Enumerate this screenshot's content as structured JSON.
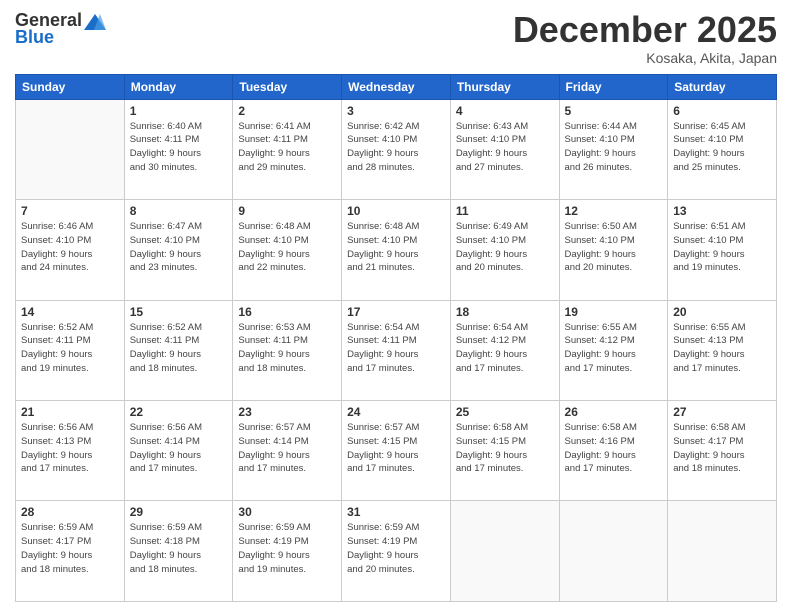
{
  "header": {
    "logo": {
      "general": "General",
      "blue": "Blue"
    },
    "title": "December 2025",
    "subtitle": "Kosaka, Akita, Japan"
  },
  "days_of_week": [
    "Sunday",
    "Monday",
    "Tuesday",
    "Wednesday",
    "Thursday",
    "Friday",
    "Saturday"
  ],
  "weeks": [
    [
      {
        "day": "",
        "info": ""
      },
      {
        "day": "1",
        "info": "Sunrise: 6:40 AM\nSunset: 4:11 PM\nDaylight: 9 hours\nand 30 minutes."
      },
      {
        "day": "2",
        "info": "Sunrise: 6:41 AM\nSunset: 4:11 PM\nDaylight: 9 hours\nand 29 minutes."
      },
      {
        "day": "3",
        "info": "Sunrise: 6:42 AM\nSunset: 4:10 PM\nDaylight: 9 hours\nand 28 minutes."
      },
      {
        "day": "4",
        "info": "Sunrise: 6:43 AM\nSunset: 4:10 PM\nDaylight: 9 hours\nand 27 minutes."
      },
      {
        "day": "5",
        "info": "Sunrise: 6:44 AM\nSunset: 4:10 PM\nDaylight: 9 hours\nand 26 minutes."
      },
      {
        "day": "6",
        "info": "Sunrise: 6:45 AM\nSunset: 4:10 PM\nDaylight: 9 hours\nand 25 minutes."
      }
    ],
    [
      {
        "day": "7",
        "info": "Sunrise: 6:46 AM\nSunset: 4:10 PM\nDaylight: 9 hours\nand 24 minutes."
      },
      {
        "day": "8",
        "info": "Sunrise: 6:47 AM\nSunset: 4:10 PM\nDaylight: 9 hours\nand 23 minutes."
      },
      {
        "day": "9",
        "info": "Sunrise: 6:48 AM\nSunset: 4:10 PM\nDaylight: 9 hours\nand 22 minutes."
      },
      {
        "day": "10",
        "info": "Sunrise: 6:48 AM\nSunset: 4:10 PM\nDaylight: 9 hours\nand 21 minutes."
      },
      {
        "day": "11",
        "info": "Sunrise: 6:49 AM\nSunset: 4:10 PM\nDaylight: 9 hours\nand 20 minutes."
      },
      {
        "day": "12",
        "info": "Sunrise: 6:50 AM\nSunset: 4:10 PM\nDaylight: 9 hours\nand 20 minutes."
      },
      {
        "day": "13",
        "info": "Sunrise: 6:51 AM\nSunset: 4:10 PM\nDaylight: 9 hours\nand 19 minutes."
      }
    ],
    [
      {
        "day": "14",
        "info": "Sunrise: 6:52 AM\nSunset: 4:11 PM\nDaylight: 9 hours\nand 19 minutes."
      },
      {
        "day": "15",
        "info": "Sunrise: 6:52 AM\nSunset: 4:11 PM\nDaylight: 9 hours\nand 18 minutes."
      },
      {
        "day": "16",
        "info": "Sunrise: 6:53 AM\nSunset: 4:11 PM\nDaylight: 9 hours\nand 18 minutes."
      },
      {
        "day": "17",
        "info": "Sunrise: 6:54 AM\nSunset: 4:11 PM\nDaylight: 9 hours\nand 17 minutes."
      },
      {
        "day": "18",
        "info": "Sunrise: 6:54 AM\nSunset: 4:12 PM\nDaylight: 9 hours\nand 17 minutes."
      },
      {
        "day": "19",
        "info": "Sunrise: 6:55 AM\nSunset: 4:12 PM\nDaylight: 9 hours\nand 17 minutes."
      },
      {
        "day": "20",
        "info": "Sunrise: 6:55 AM\nSunset: 4:13 PM\nDaylight: 9 hours\nand 17 minutes."
      }
    ],
    [
      {
        "day": "21",
        "info": "Sunrise: 6:56 AM\nSunset: 4:13 PM\nDaylight: 9 hours\nand 17 minutes."
      },
      {
        "day": "22",
        "info": "Sunrise: 6:56 AM\nSunset: 4:14 PM\nDaylight: 9 hours\nand 17 minutes."
      },
      {
        "day": "23",
        "info": "Sunrise: 6:57 AM\nSunset: 4:14 PM\nDaylight: 9 hours\nand 17 minutes."
      },
      {
        "day": "24",
        "info": "Sunrise: 6:57 AM\nSunset: 4:15 PM\nDaylight: 9 hours\nand 17 minutes."
      },
      {
        "day": "25",
        "info": "Sunrise: 6:58 AM\nSunset: 4:15 PM\nDaylight: 9 hours\nand 17 minutes."
      },
      {
        "day": "26",
        "info": "Sunrise: 6:58 AM\nSunset: 4:16 PM\nDaylight: 9 hours\nand 17 minutes."
      },
      {
        "day": "27",
        "info": "Sunrise: 6:58 AM\nSunset: 4:17 PM\nDaylight: 9 hours\nand 18 minutes."
      }
    ],
    [
      {
        "day": "28",
        "info": "Sunrise: 6:59 AM\nSunset: 4:17 PM\nDaylight: 9 hours\nand 18 minutes."
      },
      {
        "day": "29",
        "info": "Sunrise: 6:59 AM\nSunset: 4:18 PM\nDaylight: 9 hours\nand 18 minutes."
      },
      {
        "day": "30",
        "info": "Sunrise: 6:59 AM\nSunset: 4:19 PM\nDaylight: 9 hours\nand 19 minutes."
      },
      {
        "day": "31",
        "info": "Sunrise: 6:59 AM\nSunset: 4:19 PM\nDaylight: 9 hours\nand 20 minutes."
      },
      {
        "day": "",
        "info": ""
      },
      {
        "day": "",
        "info": ""
      },
      {
        "day": "",
        "info": ""
      }
    ]
  ]
}
